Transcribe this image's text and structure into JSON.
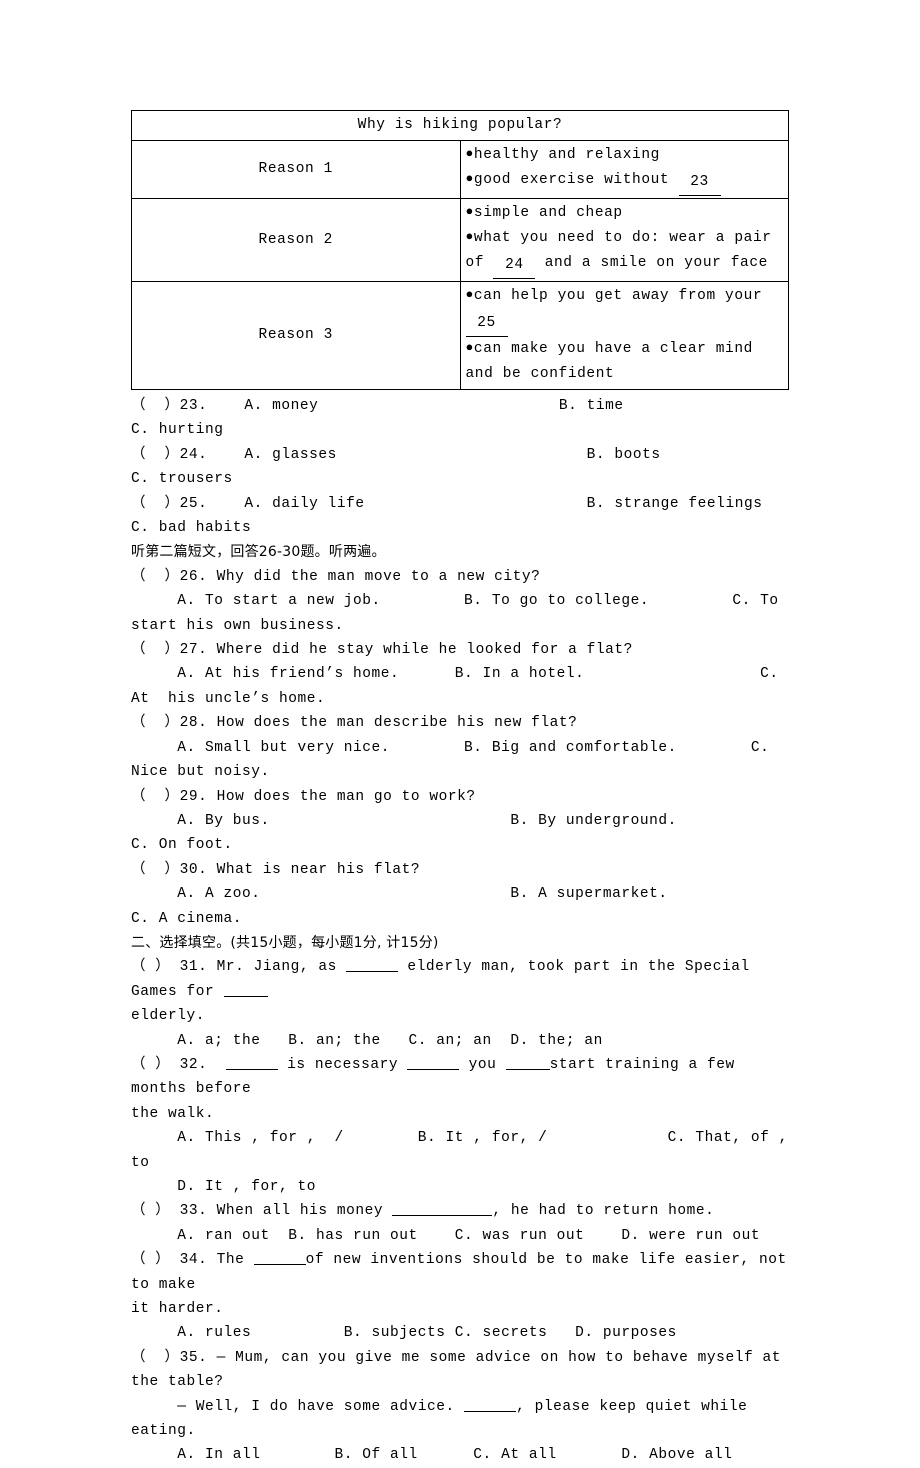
{
  "table": {
    "title": "Why is hiking popular?",
    "rows": [
      {
        "label": "Reason 1",
        "bullets": [
          {
            "pre": "healthy and relaxing",
            "blank": null,
            "post": ""
          },
          {
            "pre": "good exercise without ",
            "blank": "23",
            "post": ""
          }
        ]
      },
      {
        "label": "Reason 2",
        "bullets": [
          {
            "pre": "simple and cheap",
            "blank": null,
            "post": ""
          },
          {
            "pre": "what you need to do: wear a pair of ",
            "blank": "24",
            "post": " and a smile on your face"
          }
        ]
      },
      {
        "label": "Reason 3",
        "bullets": [
          {
            "pre": "can help you get away from your ",
            "blank": "25",
            "post": ""
          },
          {
            "pre": "can make you have a clear mind and be confident",
            "blank": null,
            "post": ""
          }
        ]
      }
    ]
  },
  "listening_part1": {
    "questions": [
      {
        "marker": "（  ）23.",
        "options_line": "    A. money                          B. time                             C. hurting"
      },
      {
        "marker": "（  ）24.",
        "options_line": "    A. glasses                           B. boots                               C. trousers"
      },
      {
        "marker": "（  ）25.",
        "options_line": "    A. daily life                        B. strange feelings                    C. bad habits"
      }
    ]
  },
  "listening_part2": {
    "heading": "听第二篇短文，回答26-30题。听两遍。",
    "questions": [
      {
        "marker": "（  ）26.",
        "stem": " Why did the man move to a new city?",
        "options_line": "     A. To start a new job.         B. To go to college.         C. To start his own business."
      },
      {
        "marker": "（  ）27.",
        "stem": " Where did he stay while he looked for a flat?",
        "options_line": "     A. At his friend’s home.      B. In a hotel.                   C.  At  his uncle’s home."
      },
      {
        "marker": "（  ）28.",
        "stem": " How does the man describe his new flat?",
        "options_line": "     A. Small but very nice.        B. Big and comfortable.        C. Nice but noisy."
      },
      {
        "marker": "（  ）29.",
        "stem": " How does the man go to work?",
        "options_line": "     A. By bus.                          B. By underground.            C. On foot."
      },
      {
        "marker": "（  ）30.",
        "stem": " What is near his flat?",
        "options_line": "     A. A zoo.                           B. A supermarket.               C. A cinema."
      }
    ]
  },
  "section2": {
    "heading": "二、选择填空。(共15小题，每小题1分, 计15分)",
    "q31": {
      "marker": "（ ） 31.",
      "pre": " Mr. Jiang, as ",
      "mid": " elderly man, took part in the Special Games for ",
      "post": "elderly.",
      "options": "     A. a; the   B. an; the   C. an; an  D. the; an"
    },
    "q32": {
      "marker": "（ ） 32.",
      "pre": "  ",
      "mid1": " is necessary ",
      "mid2": " you ",
      "mid3": "start training a few months before",
      "post": "the walk.",
      "options1": "     A. This , for ,  /        B. It , for, /             C. That, of , to",
      "options2": "     D. It , for, to"
    },
    "q33": {
      "marker": "（ ） 33.",
      "pre": " When all his money ",
      "post": ", he had to return home.",
      "options": "     A. ran out  B. has run out    C. was run out    D. were run out"
    },
    "q34": {
      "marker": "（ ） 34.",
      "pre": " The ",
      "mid": "of new inventions should be to make life easier, not to make",
      "post": "it harder.",
      "options": "     A. rules          B. subjects C. secrets   D. purposes"
    },
    "q35": {
      "marker": "（  ）35.",
      "line1": " — Mum, can you give me some advice on how to behave myself at the table?",
      "line2_pre": "     — Well, I do have some advice. ",
      "line2_post": ", please keep quiet while eating.",
      "options": "     A. In all        B. Of all      C. At all       D. Above all"
    }
  }
}
